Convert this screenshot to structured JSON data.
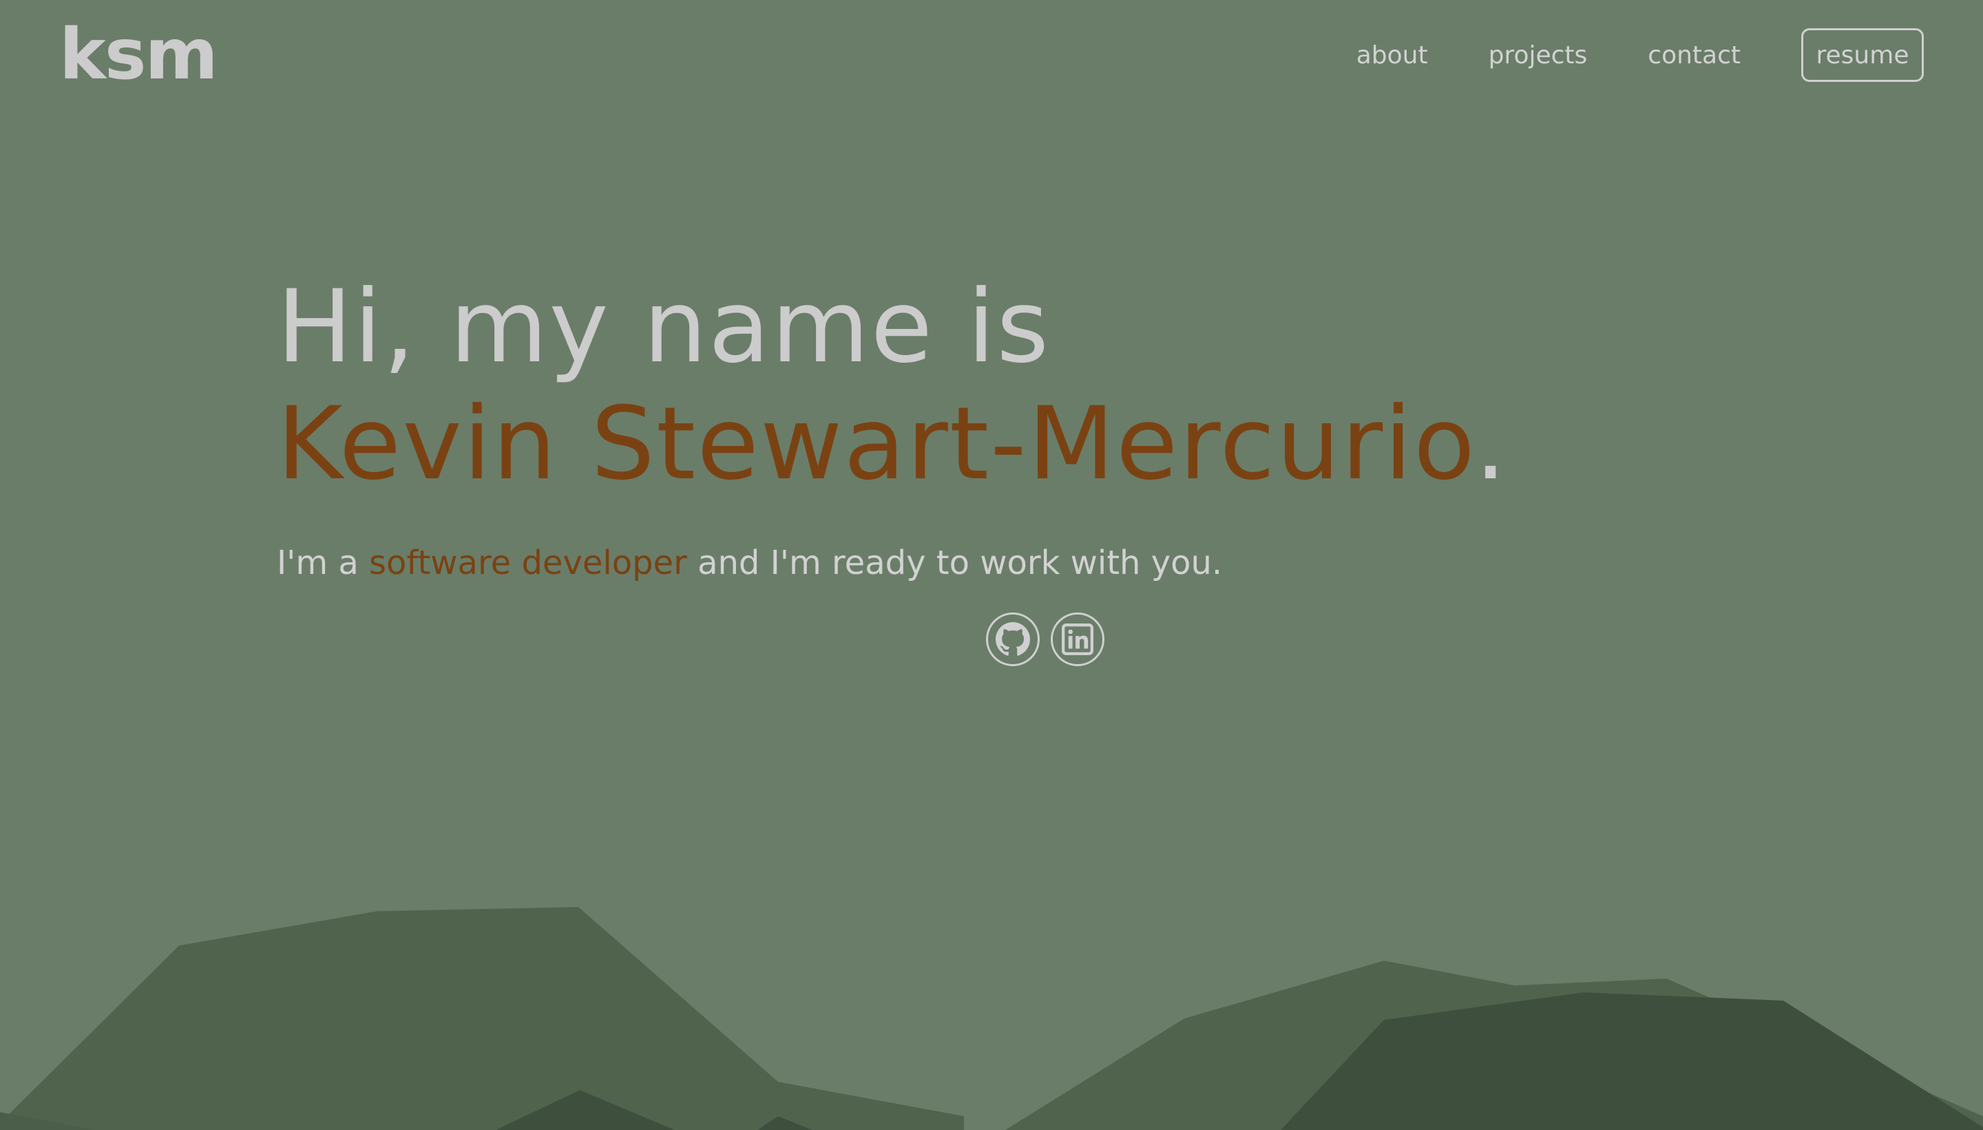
{
  "header": {
    "logo": "ksm",
    "nav": [
      {
        "label": "about"
      },
      {
        "label": "projects"
      },
      {
        "label": "contact"
      }
    ],
    "resume_label": "resume"
  },
  "hero": {
    "greeting": "Hi, my name is",
    "name": "Kevin Stewart-Mercurio",
    "name_suffix": ".",
    "tagline_prefix": "I'm a ",
    "tagline_accent": "software developer",
    "tagline_suffix": " and I'm ready to work with you.",
    "socials": [
      {
        "icon": "github-icon"
      },
      {
        "icon": "linkedin-icon"
      }
    ]
  },
  "colors": {
    "background": "#6a7d69",
    "accent": "#7a4212",
    "text": "#cccccc",
    "mountain_mid": "#4f634d",
    "mountain_dark": "#3e503d"
  }
}
